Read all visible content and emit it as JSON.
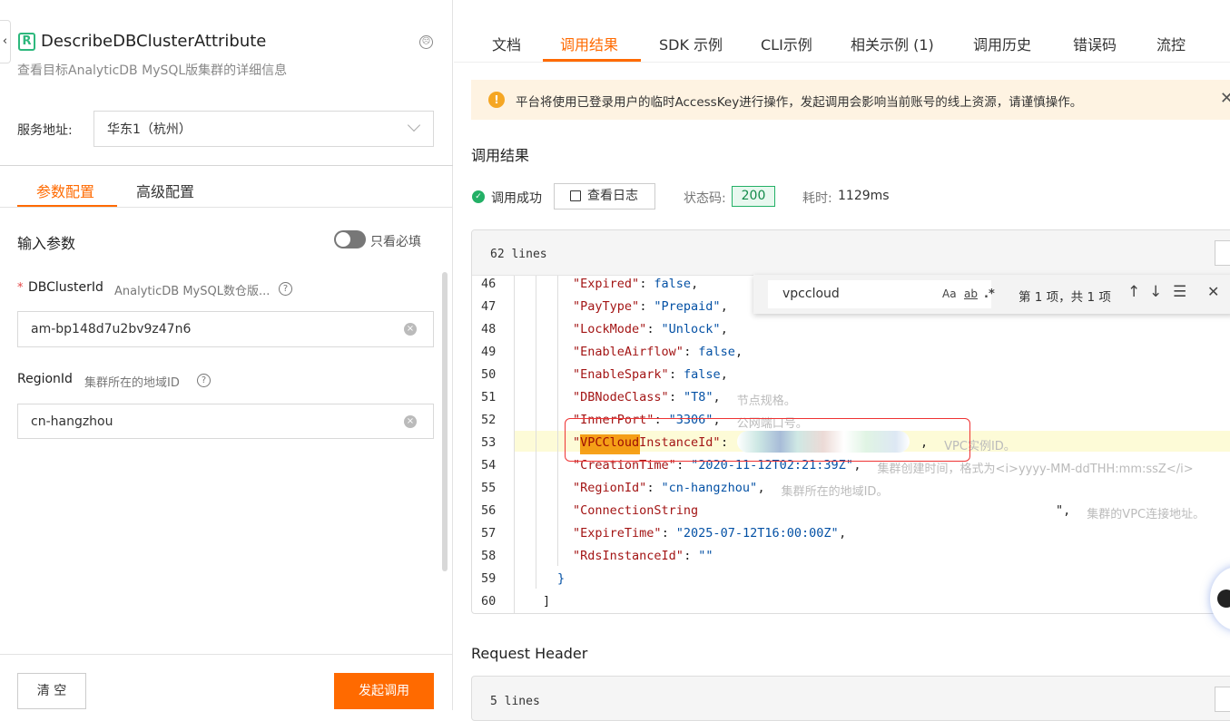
{
  "left": {
    "title": "DescribeDBClusterAttribute",
    "subtitle": "查看目标AnalyticDB MySQL版集群的详细信息",
    "service_label": "服务地址:",
    "service_value": "华东1（杭州）",
    "tabs": [
      {
        "label": "参数配置",
        "active": true
      },
      {
        "label": "高级配置",
        "active": false
      }
    ],
    "input_params_label": "输入参数",
    "required_only_label": "只看必填",
    "required_only_on": false,
    "params": [
      {
        "name": "DBClusterId",
        "required": true,
        "desc": "AnalyticDB MySQL数仓版...",
        "value": "am-bp148d7u2bv9z47n6"
      },
      {
        "name": "RegionId",
        "required": false,
        "desc": "集群所在的地域ID",
        "value": "cn-hangzhou"
      }
    ],
    "clear_label": "清 空",
    "invoke_label": "发起调用"
  },
  "right": {
    "tabs": [
      "文档",
      "调用结果",
      "SDK 示例",
      "CLI示例",
      "相关示例 (1)",
      "调用历史",
      "错误码",
      "流控"
    ],
    "active_tab": 1,
    "warning": "平台将使用已登录用户的临时AccessKey进行操作，发起调用会影响当前账号的线上资源，请谨慎操作。",
    "result_heading": "调用结果",
    "status_text": "调用成功",
    "view_log_label": "查看日志",
    "status_code_label": "状态码:",
    "status_code": "200",
    "elapsed_label": "耗时:",
    "elapsed": "1129ms",
    "code_lines_count": "62 lines",
    "find": {
      "query": "vpccloud",
      "case": "Aa",
      "word": "ab",
      "regex": ".*",
      "result": "第 1 项，共 1 项"
    },
    "lines": [
      {
        "n": "46",
        "key": "\"Expired\"",
        "val": "false",
        "end": ",",
        "comment": ""
      },
      {
        "n": "47",
        "key": "\"PayType\"",
        "val": "\"Prepaid\"",
        "end": ",",
        "comment": ""
      },
      {
        "n": "48",
        "key": "\"LockMode\"",
        "val": "\"Unlock\"",
        "end": ",",
        "comment": ""
      },
      {
        "n": "49",
        "key": "\"EnableAirflow\"",
        "val": "false",
        "end": ",",
        "comment": ""
      },
      {
        "n": "50",
        "key": "\"EnableSpark\"",
        "val": "false",
        "end": ",",
        "comment": ""
      },
      {
        "n": "51",
        "key": "\"DBNodeClass\"",
        "val": "\"T8\"",
        "end": ",",
        "comment": "节点规格。"
      },
      {
        "n": "52",
        "key": "\"InnerPort\"",
        "val": "\"3306\"",
        "end": ",",
        "comment": "公网端口号。"
      },
      {
        "n": "53",
        "key": "\"VPCCloudInstanceId\"",
        "val": "",
        "end": ",",
        "comment": "VPC实例ID。"
      },
      {
        "n": "54",
        "key": "\"CreationTime\"",
        "val": "\"2020-11-12T02:21:39Z\"",
        "end": ",",
        "comment": "集群创建时间，格式为<i>yyyy-MM-ddTHH:mm:ssZ</i>"
      },
      {
        "n": "55",
        "key": "\"RegionId\"",
        "val": "\"cn-hangzhou\"",
        "end": ",",
        "comment": "集群所在的地域ID。"
      },
      {
        "n": "56",
        "key": "\"ConnectionString",
        "val": "",
        "end": "\",",
        "comment": "集群的VPC连接地址。"
      },
      {
        "n": "57",
        "key": "\"ExpireTime\"",
        "val": "\"2025-07-12T16:00:00Z\"",
        "end": ",",
        "comment": ""
      },
      {
        "n": "58",
        "key": "\"RdsInstanceId\"",
        "val": "\"\"",
        "end": "",
        "comment": ""
      }
    ],
    "line59": {
      "n": "59",
      "text": "}"
    },
    "line60": {
      "n": "60",
      "text": "]"
    },
    "request_header_heading": "Request Header",
    "request_header_lines": "5 lines"
  },
  "colors": {
    "accent": "#ff6a00",
    "success": "#23b066",
    "warning_bg": "#fef3e2"
  }
}
